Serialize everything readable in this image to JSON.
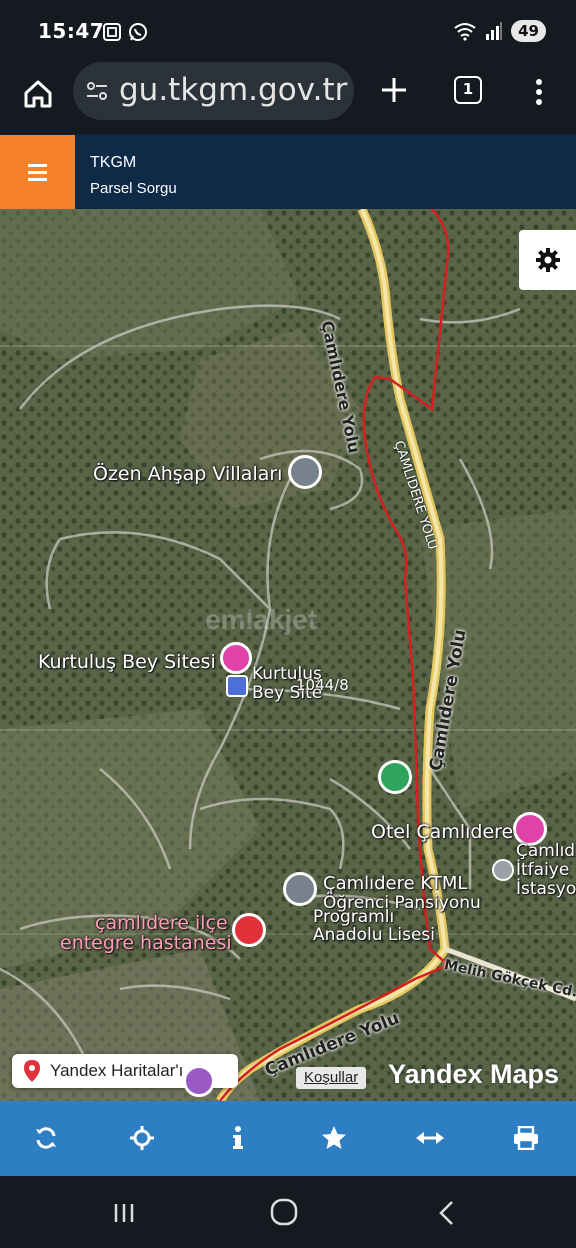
{
  "status_bar": {
    "time": "15:47",
    "battery": "49",
    "left_icons": [
      "screenshot-icon",
      "whatsapp-icon"
    ],
    "right_icons": [
      "wifi-icon",
      "signal-icon"
    ]
  },
  "browser": {
    "url": "gu.tkgm.gov.tr",
    "tab_count": "1"
  },
  "app_header": {
    "title": "TKGM",
    "subtitle": "Parsel Sorgu",
    "menu_color": "#f58228",
    "bg_color": "#0e2a47"
  },
  "map": {
    "places": {
      "ozen": "Özen Ahşap Villaları",
      "kurtulus_site": "Kurtuluş Bey Sitesi",
      "kurtulus_hotel_1": "Kurtuluş",
      "kurtulus_hotel_2": "Bey Site",
      "otel": "Otel Çamlıdere",
      "itfaiye_1": "Çamlıd",
      "itfaiye_2": "İtfaiye",
      "itfaiye_3": "İstasyo",
      "ktml_1": "Çamlıdere KTML",
      "ktml_2": "Öğrenci Pansiyonu",
      "lise_1": "Programlı",
      "lise_2": "Anadolu Lisesi",
      "hastane_1": "çamlıdere ilçe",
      "hastane_2": "entegre hastanesi"
    },
    "roads": {
      "top": "Çamlıdere Yolu",
      "upper": "ÇAMLIDERE YOLU",
      "mid": "Çamlıdere Yolu",
      "bottom": "Çamlıdere Yolu",
      "melih": "Melih Gökçek Cd."
    },
    "parcel_label": "1044/8",
    "watermark": "emlakjet",
    "yandex_link": "Yandex Haritalar'ı aç",
    "terms": "Koşullar",
    "brand": "Yandex Maps",
    "parcel_color": "#d42020"
  },
  "toolbar": {
    "buttons": [
      "refresh-icon",
      "locate-icon",
      "info-icon",
      "star-icon",
      "measure-icon",
      "print-icon"
    ],
    "color": "#2e7ec3"
  },
  "nav": {
    "buttons": [
      "recents-icon",
      "home-icon",
      "back-icon"
    ]
  }
}
